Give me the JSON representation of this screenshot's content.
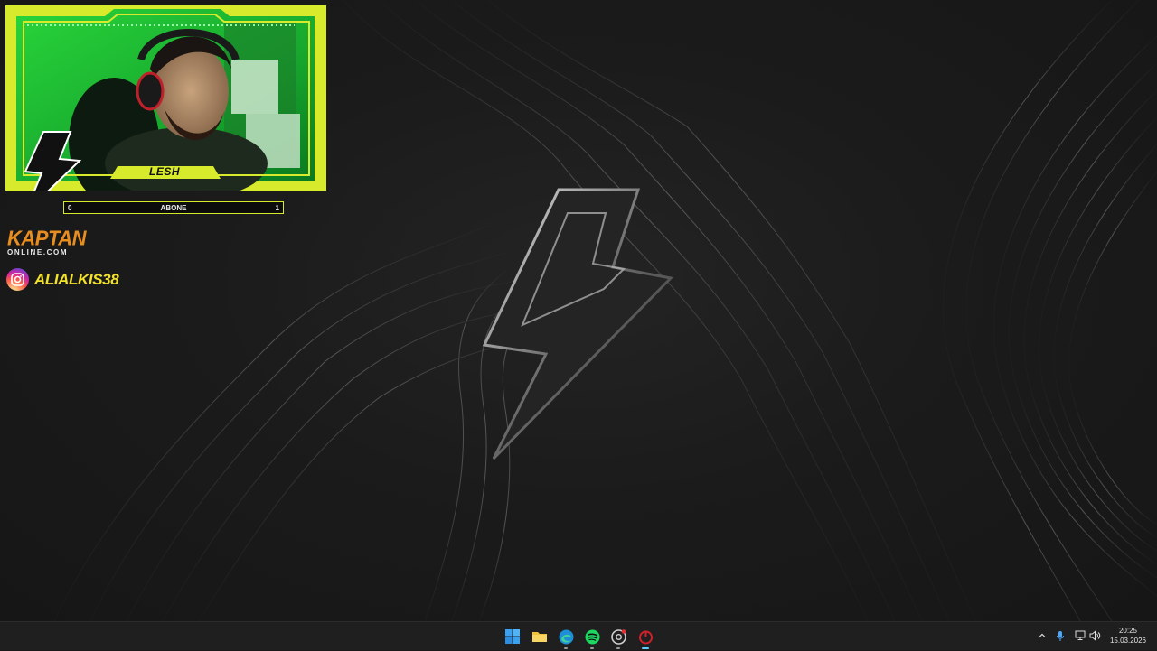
{
  "overlay": {
    "cam_label": "LESH",
    "subscriber_goal": {
      "label": "ABONE",
      "min": "0",
      "max": "1",
      "progress": 0
    },
    "sponsor": {
      "name": "KAPTAN",
      "domain": "ONLINE.COM"
    },
    "instagram": {
      "icon": "instagram-icon",
      "handle": "ALIALKIS38"
    }
  },
  "taskbar": {
    "apps": [
      {
        "name": "start",
        "icon": "windows-logo-icon"
      },
      {
        "name": "file-explorer",
        "icon": "folder-icon"
      },
      {
        "name": "edge",
        "icon": "edge-icon"
      },
      {
        "name": "spotify",
        "icon": "spotify-icon"
      },
      {
        "name": "chrome",
        "icon": "chrome-icon"
      },
      {
        "name": "recorder",
        "icon": "power-ring-icon"
      }
    ],
    "tray": {
      "icons": [
        "chevron-up-icon",
        "microphone-icon",
        "display-icon",
        "volume-icon"
      ],
      "time": "20:25",
      "date": "15.03.2026"
    }
  },
  "colors": {
    "overlay_yellow": "#d8ea2c",
    "cam_green": "#1fc43b",
    "sponsor_orange": "#e88d1f",
    "instagram_handle": "#f3e22c",
    "taskbar_bg": "#1f1f1f",
    "active_indicator": "#60cdff"
  }
}
